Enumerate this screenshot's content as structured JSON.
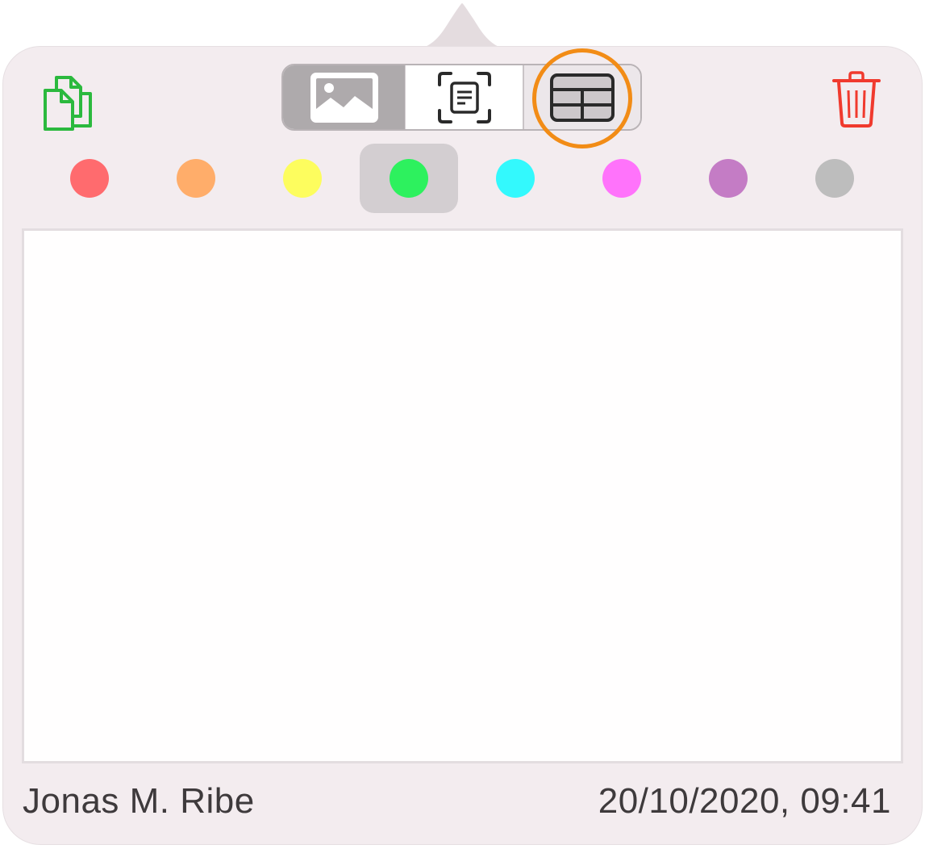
{
  "toolbar": {
    "copy_icon": "copy-icon",
    "trash_icon": "trash-icon",
    "modes": [
      {
        "id": "image",
        "icon": "image-icon",
        "state": "selected"
      },
      {
        "id": "text",
        "icon": "text-scan-icon",
        "state": "normal"
      },
      {
        "id": "table",
        "icon": "table-icon",
        "state": "highlighted"
      }
    ]
  },
  "colors": {
    "options": [
      "#ff6b6e",
      "#ffad6a",
      "#fdfd5e",
      "#2df15e",
      "#33f9fd",
      "#ff73fb",
      "#c47cc5",
      "#bdbdbd"
    ],
    "selected_index": 3
  },
  "note": {
    "value": ""
  },
  "footer": {
    "author": "Jonas M. Ribe",
    "timestamp": "20/10/2020, 09:41"
  },
  "theme": {
    "panel_bg": "#f3ecef",
    "copy_icon_color": "#2bb93e",
    "trash_icon_color": "#f03a2e",
    "highlight_ring": "#f28c16"
  }
}
